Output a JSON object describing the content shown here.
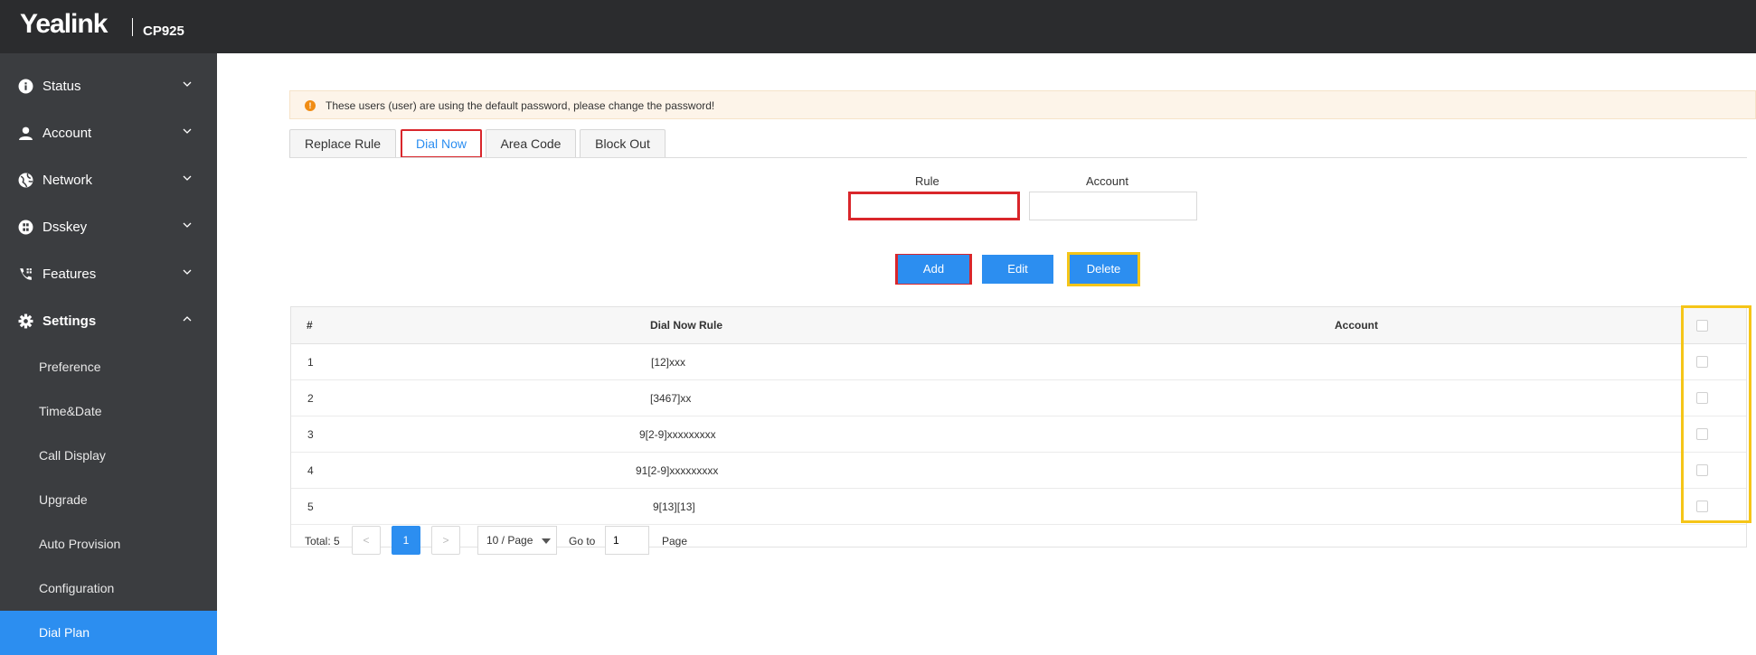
{
  "header": {
    "brand": "Yealink",
    "model": "CP925"
  },
  "sidebar": {
    "items": [
      {
        "label": "Status",
        "icon": "info-icon"
      },
      {
        "label": "Account",
        "icon": "user-icon"
      },
      {
        "label": "Network",
        "icon": "globe-icon"
      },
      {
        "label": "Dsskey",
        "icon": "grid-icon"
      },
      {
        "label": "Features",
        "icon": "phone-icon"
      },
      {
        "label": "Settings",
        "icon": "gear-icon",
        "expanded": true
      }
    ],
    "sub_items": [
      {
        "label": "Preference"
      },
      {
        "label": "Time&Date"
      },
      {
        "label": "Call Display"
      },
      {
        "label": "Upgrade"
      },
      {
        "label": "Auto Provision"
      },
      {
        "label": "Configuration"
      },
      {
        "label": "Dial Plan",
        "active": true
      }
    ]
  },
  "warning": {
    "text": "These users (user) are using the default password, please change the password!"
  },
  "tabs": [
    {
      "label": "Replace Rule"
    },
    {
      "label": "Dial Now",
      "active": true
    },
    {
      "label": "Area Code"
    },
    {
      "label": "Block Out"
    }
  ],
  "form": {
    "rule_label": "Rule",
    "rule_value": "",
    "account_label": "Account",
    "account_value": ""
  },
  "buttons": {
    "add": "Add",
    "edit": "Edit",
    "delete": "Delete"
  },
  "table": {
    "columns": [
      "#",
      "Dial Now Rule",
      "Account"
    ],
    "rows": [
      {
        "index": "1",
        "rule": "[12]xxx",
        "account": ""
      },
      {
        "index": "2",
        "rule": "[3467]xx",
        "account": ""
      },
      {
        "index": "3",
        "rule": "9[2-9]xxxxxxxxx",
        "account": ""
      },
      {
        "index": "4",
        "rule": "91[2-9]xxxxxxxxx",
        "account": ""
      },
      {
        "index": "5",
        "rule": "9[13][13]",
        "account": ""
      }
    ]
  },
  "pagination": {
    "total": "Total: 5",
    "prev": "<",
    "current": "1",
    "next": ">",
    "page_size": "10 / Page",
    "goto_label": "Go to",
    "goto_value": "1",
    "page_label": "Page"
  },
  "colors": {
    "accent": "#2c8ef0",
    "sidebar": "#3b3d40",
    "topbar": "#2b2c2e",
    "highlight_red": "#d9262b",
    "highlight_yellow": "#f5c518"
  }
}
